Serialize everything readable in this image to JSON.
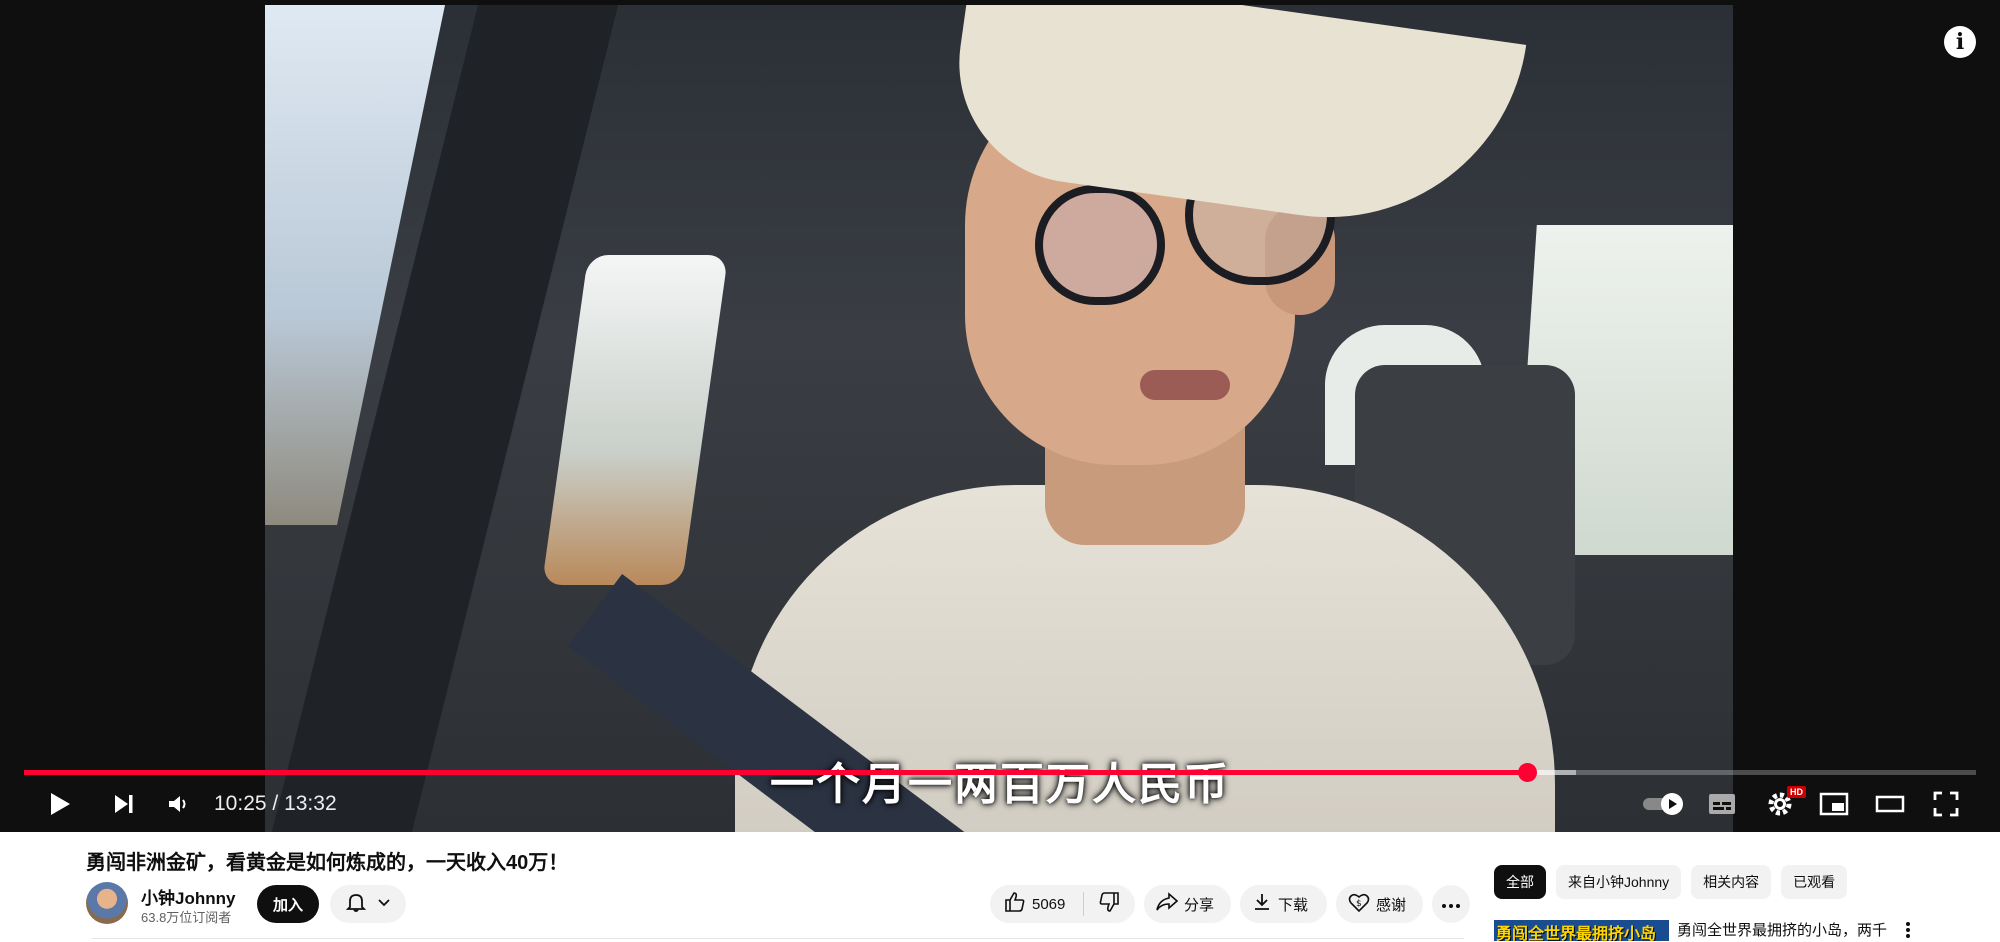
{
  "player": {
    "subtitle": "一个月一两百万人民币",
    "time_current": "10:25",
    "time_separator": " / ",
    "time_total": "13:32",
    "progress_fraction": 0.77,
    "buffered_fraction": 0.795,
    "quality_badge": "HD",
    "accent_color": "#ff0033",
    "icons": [
      "play-icon",
      "next-icon",
      "volume-icon",
      "autoplay-toggle",
      "subtitles-icon",
      "settings-icon",
      "miniplayer-icon",
      "theater-icon",
      "fullscreen-icon",
      "info-icon"
    ]
  },
  "video": {
    "title": "勇闯非洲金矿，看黄金是如何炼成的，一天收入40万！",
    "channel_name": "小钟Johnny",
    "subscribers": "63.8万位订阅者",
    "join_label": "加入",
    "like_count": "5069",
    "share_label": "分享",
    "download_label": "下载",
    "thanks_label": "感谢"
  },
  "sidebar": {
    "chips": [
      {
        "label": "全部",
        "active": true
      },
      {
        "label": "来自小钟Johnny",
        "active": false
      },
      {
        "label": "相关内容",
        "active": false
      },
      {
        "label": "已观看",
        "active": false
      }
    ],
    "recommendation": {
      "thumb_text": "勇闯全世界最拥挤小岛",
      "title": "勇闯全世界最拥挤的小岛，两千"
    }
  }
}
